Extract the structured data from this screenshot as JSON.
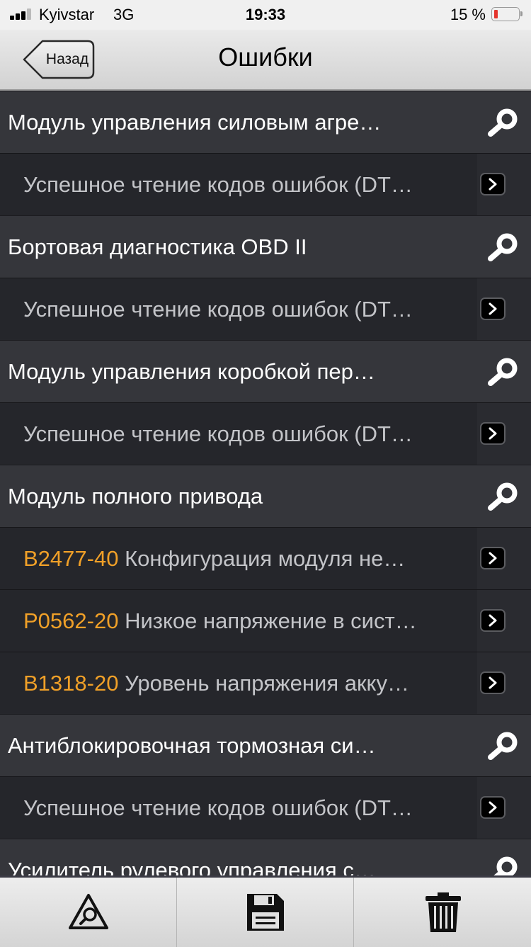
{
  "status_bar": {
    "carrier": "Kyivstar",
    "network": "3G",
    "time": "19:33",
    "battery_percent": "15 %",
    "battery_level": 0.15
  },
  "nav": {
    "back_label": "Назад",
    "title": "Ошибки"
  },
  "list": [
    {
      "type": "header",
      "text": "Модуль управления силовым агре…",
      "icon": "search-icon"
    },
    {
      "type": "sub",
      "code": "",
      "text": "Успешное чтение кодов ошибок (DT…",
      "icon": "chevron-right-icon"
    },
    {
      "type": "header",
      "text": "Бортовая диагностика OBD II",
      "icon": "search-icon"
    },
    {
      "type": "sub",
      "code": "",
      "text": "Успешное чтение кодов ошибок (DT…",
      "icon": "chevron-right-icon"
    },
    {
      "type": "header",
      "text": "Модуль управления коробкой пер…",
      "icon": "search-icon"
    },
    {
      "type": "sub",
      "code": "",
      "text": "Успешное чтение кодов ошибок (DT…",
      "icon": "chevron-right-icon"
    },
    {
      "type": "header",
      "text": "Модуль полного привода",
      "icon": "search-icon"
    },
    {
      "type": "sub",
      "code": "B2477-40",
      "text": "Конфигурация модуля не…",
      "icon": "chevron-right-icon"
    },
    {
      "type": "sub",
      "code": "P0562-20",
      "text": "Низкое напряжение в сист…",
      "icon": "chevron-right-icon"
    },
    {
      "type": "sub",
      "code": "B1318-20",
      "text": "Уровень напряжения акку…",
      "icon": "chevron-right-icon"
    },
    {
      "type": "header",
      "text": "Антиблокировочная тормозная си…",
      "icon": "search-icon"
    },
    {
      "type": "sub",
      "code": "",
      "text": "Успешное чтение кодов ошибок (DT…",
      "icon": "chevron-right-icon"
    },
    {
      "type": "header",
      "text": "Усилитель рулевого управления с…",
      "icon": "search-icon"
    }
  ],
  "toolbar": {
    "items": [
      {
        "icon": "warning-search-icon"
      },
      {
        "icon": "save-icon"
      },
      {
        "icon": "trash-icon"
      }
    ]
  },
  "colors": {
    "header_row": "#35363b",
    "sub_row": "#25262b",
    "error_code": "#f0a028",
    "battery_low": "#e5352e"
  }
}
